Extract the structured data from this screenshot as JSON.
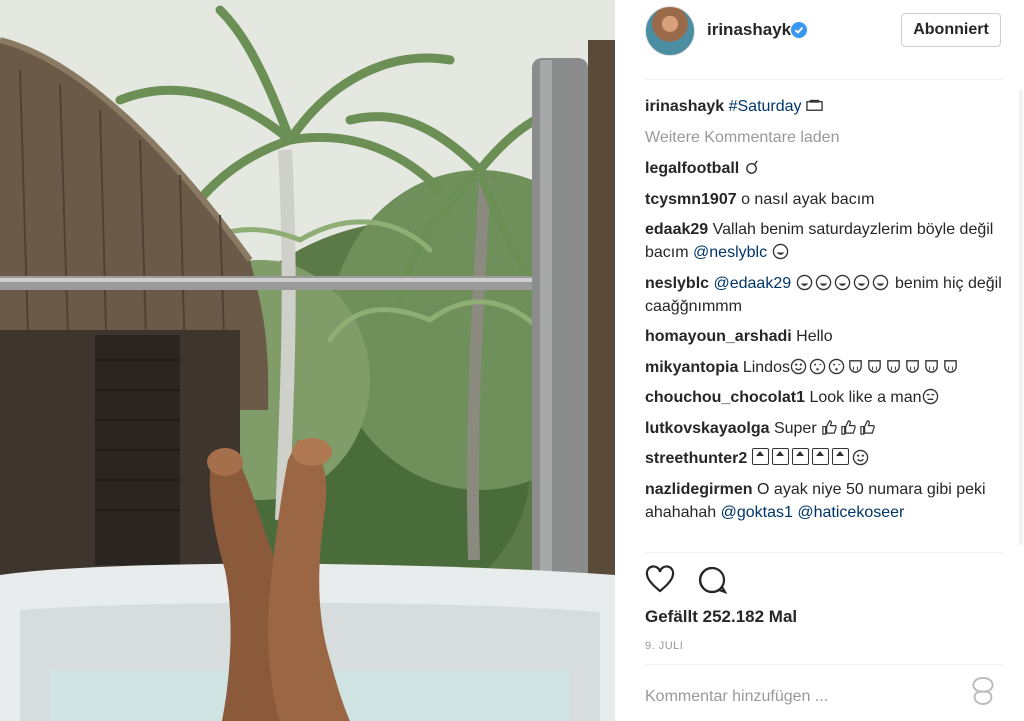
{
  "post": {
    "username": "irinashayk",
    "follow_label": "Abonniert",
    "caption_user": "irinashayk",
    "caption_tag": "#Saturday",
    "load_more": "Weitere Kommentare laden",
    "likes": "Gefällt 252.182 Mal",
    "date": "9. JULI",
    "add_comment_placeholder": "Kommentar hinzufügen ..."
  },
  "comments": [
    {
      "user": "legalfootball",
      "text": ""
    },
    {
      "user": "tcysmn1907",
      "text": "o nasıl ayak bacım"
    },
    {
      "user": "edaak29",
      "text": "Vallah benim saturdayzlerim böyle değil bacım",
      "mention": "@neslyblc"
    },
    {
      "user": "neslyblc",
      "mention": "@edaak29",
      "text": "benim hiç değil caağğnımmm"
    },
    {
      "user": "homayoun_arshadi",
      "text": "Hello"
    },
    {
      "user": "mikyantopia",
      "text": "Lindos"
    },
    {
      "user": "chouchou_chocolat1",
      "text": "Look like a man"
    },
    {
      "user": "lutkovskayaolga",
      "text": "Super"
    },
    {
      "user": "streethunter2",
      "text": ""
    },
    {
      "user": "nazlidegirmen",
      "text": "O ayak niye 50 numara gibi peki ahahahah",
      "mention1": "@goktas1",
      "mention2": "@haticekoseer"
    }
  ],
  "colors": {
    "link": "#003569",
    "verified": "#3897f0",
    "muted": "#999999"
  },
  "icons": [
    "verified-badge-icon",
    "heart-icon",
    "comment-icon",
    "more-options-icon"
  ]
}
